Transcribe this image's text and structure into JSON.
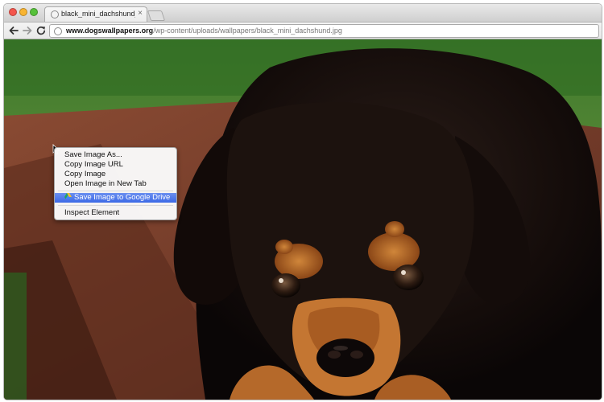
{
  "browser": {
    "tab": {
      "title": "black_mini_dachshund_pupp",
      "close_glyph": "×"
    },
    "address_bar": {
      "host": "www.dogswallpapers.org",
      "path": "/wp-content/uploads/wallpapers/black_mini_dachshund.jpg"
    },
    "icons": [
      "close-window-icon",
      "minimize-window-icon",
      "maximize-window-icon",
      "page-favicon-icon",
      "new-tab-icon",
      "back-icon",
      "forward-icon",
      "reload-icon",
      "site-info-icon",
      "google-drive-icon",
      "mouse-pointer-icon"
    ]
  },
  "image": {
    "subject": "black and tan dachshund puppy photo"
  },
  "context_menu": {
    "items": [
      {
        "label": "Save Image As..."
      },
      {
        "label": "Copy Image URL"
      },
      {
        "label": "Copy Image"
      },
      {
        "label": "Open Image in New Tab"
      },
      {
        "label": "Save Image to Google Drive",
        "highlighted": true
      },
      {
        "label": "Inspect Element"
      }
    ]
  },
  "colors": {
    "highlight": "#3c69e6",
    "traffic_close": "#f4564d",
    "traffic_min": "#f8b431",
    "traffic_max": "#56c13a"
  }
}
